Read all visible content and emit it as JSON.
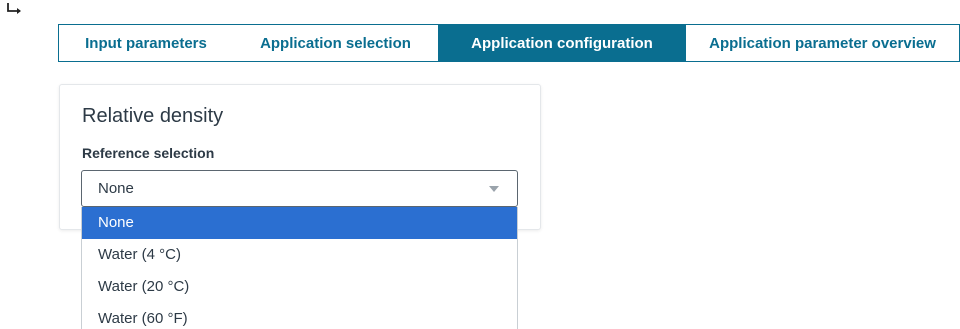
{
  "tabs": [
    {
      "label": "Input parameters",
      "active": false
    },
    {
      "label": "Application selection",
      "active": false
    },
    {
      "label": "Application configuration",
      "active": true
    },
    {
      "label": "Application parameter overview",
      "active": false
    }
  ],
  "card": {
    "title": "Relative density",
    "field_label": "Reference selection"
  },
  "select": {
    "value": "None",
    "options": [
      "None",
      "Water (4 °C)",
      "Water (20 °C)",
      "Water (60 °F)"
    ],
    "highlighted_option": "None"
  },
  "colors": {
    "accent": "#0a6e90",
    "highlight": "#2b6fd1",
    "text": "#2d3a46"
  },
  "icons": {
    "back": "return-arrow-icon",
    "caret": "chevron-down-icon"
  }
}
